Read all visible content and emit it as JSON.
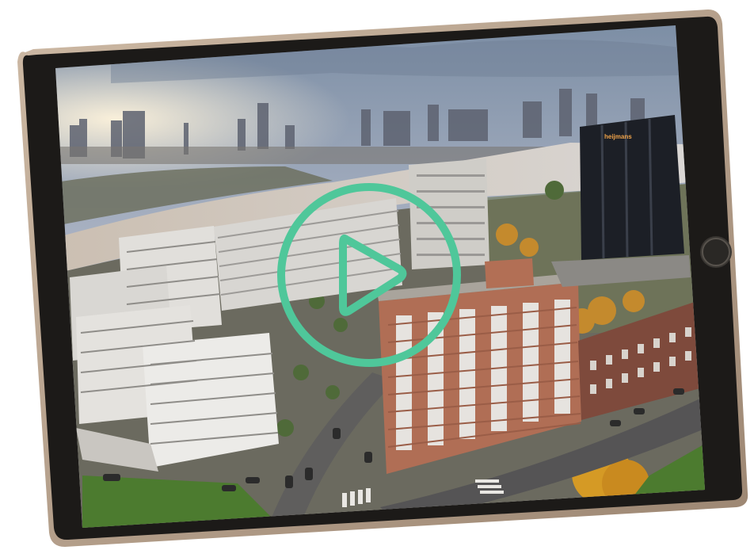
{
  "scene": {
    "description_free": true,
    "building_sign": "heijmans",
    "colors": {
      "bezel": "#1c1a18",
      "frame": "#b9a48f",
      "play_accent": "#4fc79a",
      "sky_top": "#7d8ea3",
      "sky_glow": "#f3e2c3",
      "river": "#cfc9c2"
    }
  },
  "controls": {
    "play_icon": "play-icon",
    "home_button_icon": "home-button-icon"
  }
}
